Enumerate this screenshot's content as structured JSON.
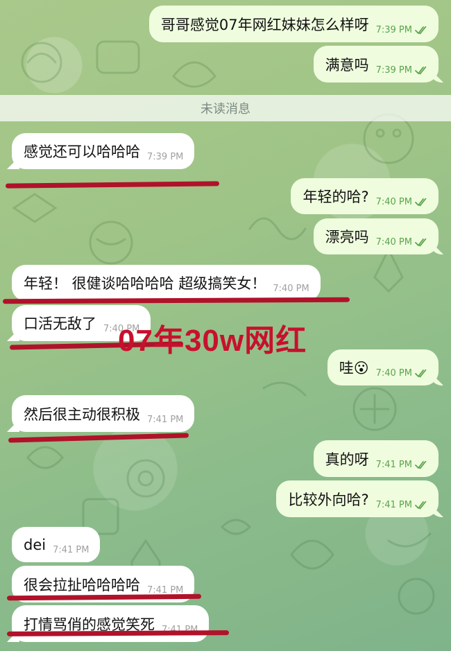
{
  "unread_label": "未读消息",
  "overlay_text": "07年30w网红",
  "colors": {
    "outgoing_bubble": "#effdde",
    "incoming_bubble": "#ffffff",
    "check": "#5aa34b",
    "highlight": "#b0122a"
  },
  "messages": [
    {
      "dir": "out",
      "text": "哥哥感觉07年网红妹妹怎么样呀",
      "time": "7:39 PM",
      "status": "read"
    },
    {
      "dir": "out",
      "text": "满意吗",
      "time": "7:39 PM",
      "status": "read"
    },
    {
      "dir": "in",
      "text": "感觉还可以哈哈哈",
      "time": "7:39 PM"
    },
    {
      "dir": "out",
      "text": "年轻的哈?",
      "time": "7:40 PM",
      "status": "read"
    },
    {
      "dir": "out",
      "text": "漂亮吗",
      "time": "7:40 PM",
      "status": "read"
    },
    {
      "dir": "in",
      "text": "年轻！ 很健谈哈哈哈哈 超级搞笑女！",
      "time": "7:40 PM"
    },
    {
      "dir": "in",
      "text": "口活无敌了",
      "time": "7:40 PM"
    },
    {
      "dir": "out",
      "text": "哇😮",
      "time": "7:40 PM",
      "status": "read"
    },
    {
      "dir": "in",
      "text": "然后很主动很积极",
      "time": "7:41 PM"
    },
    {
      "dir": "out",
      "text": "真的呀",
      "time": "7:41 PM",
      "status": "read"
    },
    {
      "dir": "out",
      "text": "比较外向哈?",
      "time": "7:41 PM",
      "status": "read"
    },
    {
      "dir": "in",
      "text": "dei",
      "time": "7:41 PM"
    },
    {
      "dir": "in",
      "text": "很会拉扯哈哈哈哈",
      "time": "7:41 PM"
    },
    {
      "dir": "in",
      "text": "打情骂俏的感觉笑死",
      "time": "7:41 PM"
    }
  ]
}
